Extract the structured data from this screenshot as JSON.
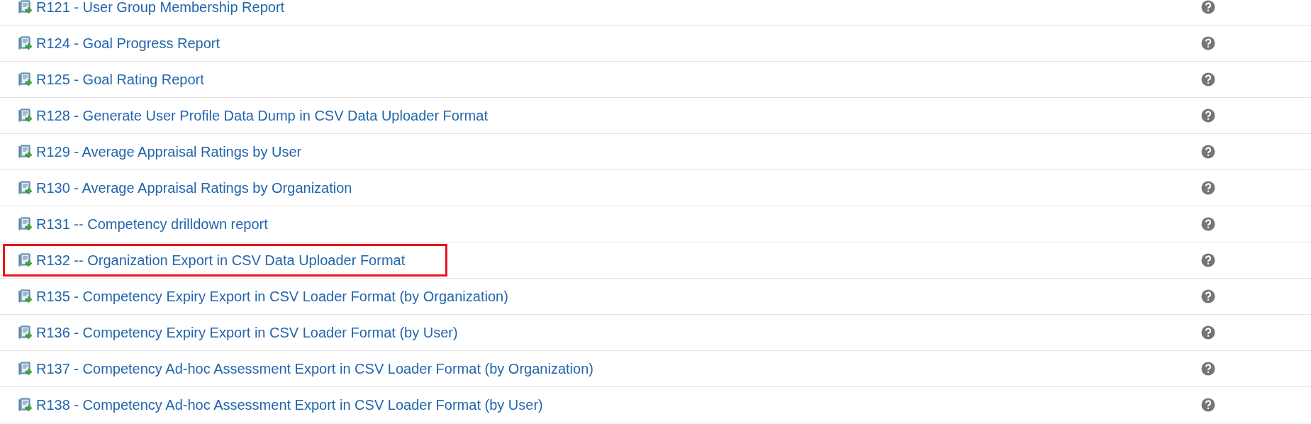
{
  "reports": [
    {
      "title": "R121 - User Group Membership Report",
      "highlighted": false
    },
    {
      "title": "R124 - Goal Progress Report",
      "highlighted": false
    },
    {
      "title": "R125 - Goal Rating Report",
      "highlighted": false
    },
    {
      "title": "R128 - Generate User Profile Data Dump in CSV Data Uploader Format",
      "highlighted": false
    },
    {
      "title": "R129 - Average Appraisal Ratings by User",
      "highlighted": false
    },
    {
      "title": "R130 - Average Appraisal Ratings by Organization",
      "highlighted": false
    },
    {
      "title": "R131 -- Competency drilldown report",
      "highlighted": false
    },
    {
      "title": "R132 -- Organization Export in CSV Data Uploader Format",
      "highlighted": true
    },
    {
      "title": "R135 - Competency Expiry Export in CSV Loader Format (by Organization)",
      "highlighted": false
    },
    {
      "title": "R136 - Competency Expiry Export in CSV Loader Format (by User)",
      "highlighted": false
    },
    {
      "title": "R137 - Competency Ad-hoc Assessment Export in CSV Loader Format (by Organization)",
      "highlighted": false
    },
    {
      "title": "R138 - Competency Ad-hoc Assessment Export in CSV Loader Format (by User)",
      "highlighted": false
    }
  ]
}
